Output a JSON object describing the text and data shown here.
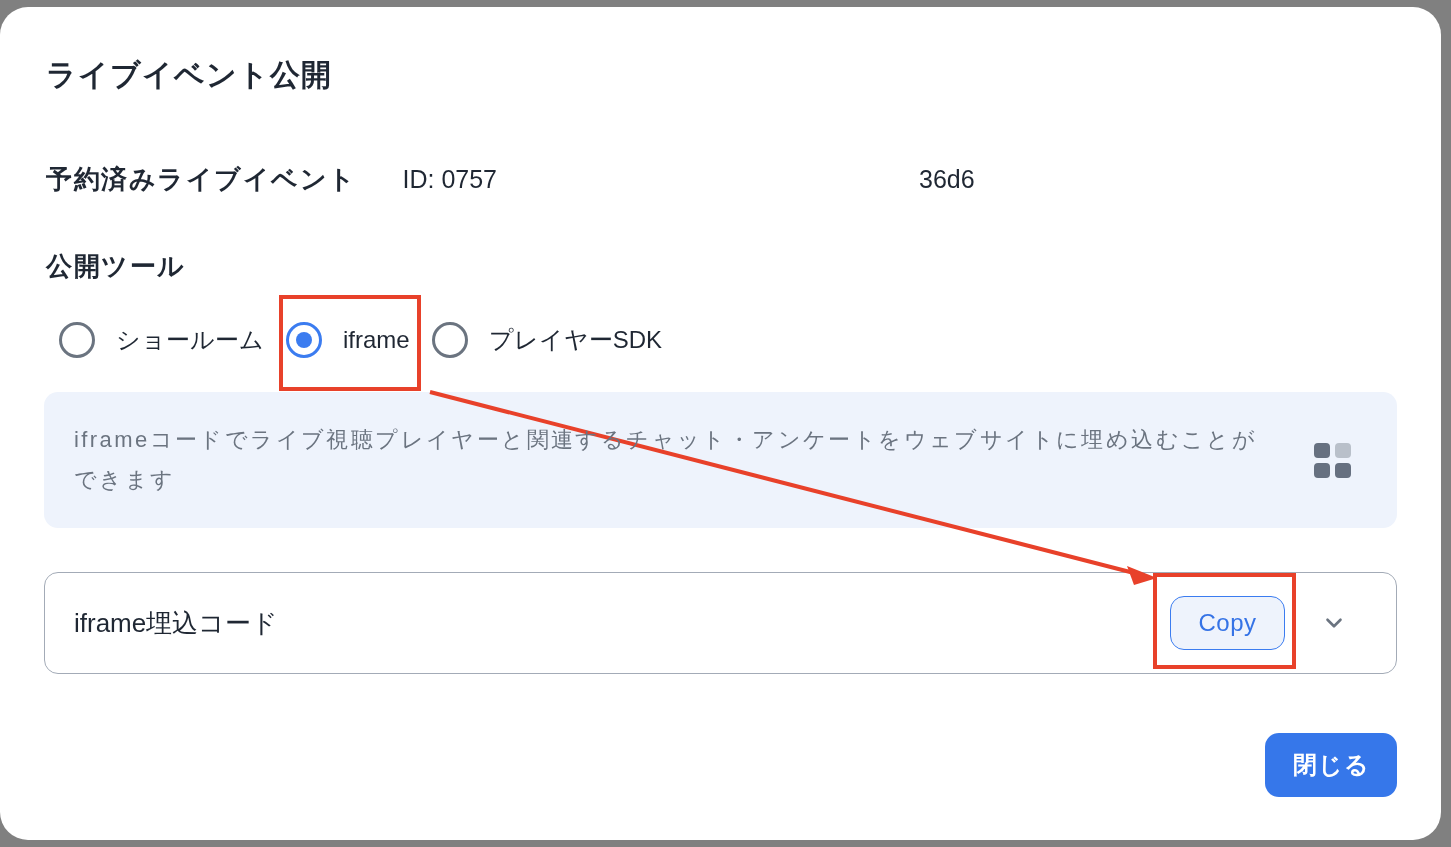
{
  "dialog": {
    "title": "ライブイベント公開"
  },
  "reserved_event": {
    "label": "予約済みライブイベント",
    "id_start": "ID: 0757",
    "id_end": "36d6"
  },
  "tools": {
    "label": "公開ツール",
    "options": [
      {
        "label": "ショールーム",
        "selected": false,
        "highlighted": false
      },
      {
        "label": "iframe",
        "selected": true,
        "highlighted": true
      },
      {
        "label": "プレイヤーSDK",
        "selected": false,
        "highlighted": false
      }
    ]
  },
  "info": {
    "text": "iframeコードでライブ視聴プレイヤーと関連するチャット・アンケートをウェブサイトに埋め込むことができます"
  },
  "embed_code": {
    "label": "iframe埋込コード",
    "copy_button": {
      "label": "Copy",
      "highlighted": true
    },
    "expanded": false
  },
  "annotation_arrow": true,
  "close_button": "閉じる"
}
